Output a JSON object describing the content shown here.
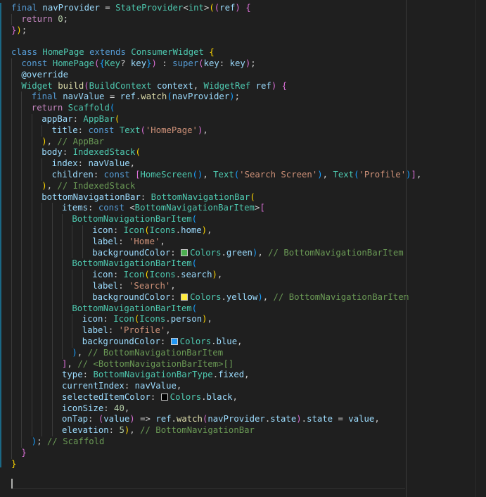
{
  "editor": {
    "language": "dart",
    "indent_guide_color": "#3a3a3a",
    "change_bar_color": "#1b81a8",
    "lines": [
      {
        "indent": 0,
        "tokens": [
          [
            "k",
            "final "
          ],
          [
            "v",
            "navProvider "
          ],
          [
            "p",
            "= "
          ],
          [
            "t",
            "StateProvider"
          ],
          [
            "p",
            "<"
          ],
          [
            "t",
            "int"
          ],
          [
            "p",
            ">"
          ],
          [
            "b1",
            "("
          ],
          [
            "b2",
            "("
          ],
          [
            "v",
            "ref"
          ],
          [
            "b2",
            ")"
          ],
          [
            "p",
            " "
          ],
          [
            "b2",
            "{"
          ]
        ]
      },
      {
        "indent": 1,
        "tokens": [
          [
            "kc",
            "return "
          ],
          [
            "n",
            "0"
          ],
          [
            "p",
            ";"
          ]
        ]
      },
      {
        "indent": 0,
        "tokens": [
          [
            "b2",
            "}"
          ],
          [
            "b1",
            ")"
          ],
          [
            "p",
            ";"
          ]
        ]
      },
      {
        "indent": 0,
        "tokens": []
      },
      {
        "indent": 0,
        "tokens": [
          [
            "k",
            "class "
          ],
          [
            "t",
            "HomePage "
          ],
          [
            "k",
            "extends "
          ],
          [
            "t",
            "ConsumerWidget "
          ],
          [
            "b1",
            "{"
          ]
        ]
      },
      {
        "indent": 1,
        "tokens": [
          [
            "k",
            "const "
          ],
          [
            "t",
            "HomePage"
          ],
          [
            "b2",
            "("
          ],
          [
            "b3",
            "{"
          ],
          [
            "t",
            "Key"
          ],
          [
            "p",
            "? "
          ],
          [
            "v",
            "key"
          ],
          [
            "b3",
            "}"
          ],
          [
            "b2",
            ")"
          ],
          [
            "p",
            " : "
          ],
          [
            "k",
            "super"
          ],
          [
            "b2",
            "("
          ],
          [
            "v",
            "key"
          ],
          [
            "p",
            ": "
          ],
          [
            "v",
            "key"
          ],
          [
            "b2",
            ")"
          ],
          [
            "p",
            ";"
          ]
        ]
      },
      {
        "indent": 1,
        "tokens": [
          [
            "v",
            "@override"
          ]
        ]
      },
      {
        "indent": 1,
        "tokens": [
          [
            "t",
            "Widget "
          ],
          [
            "f",
            "build"
          ],
          [
            "b2",
            "("
          ],
          [
            "t",
            "BuildContext "
          ],
          [
            "v",
            "context"
          ],
          [
            "p",
            ", "
          ],
          [
            "t",
            "WidgetRef "
          ],
          [
            "v",
            "ref"
          ],
          [
            "b2",
            ")"
          ],
          [
            "p",
            " "
          ],
          [
            "b2",
            "{"
          ]
        ]
      },
      {
        "indent": 2,
        "tokens": [
          [
            "k",
            "final "
          ],
          [
            "v",
            "navValue "
          ],
          [
            "p",
            "= "
          ],
          [
            "v",
            "ref"
          ],
          [
            "p",
            "."
          ],
          [
            "f",
            "watch"
          ],
          [
            "b3",
            "("
          ],
          [
            "v",
            "navProvider"
          ],
          [
            "b3",
            ")"
          ],
          [
            "p",
            ";"
          ]
        ]
      },
      {
        "indent": 2,
        "tokens": [
          [
            "kc",
            "return "
          ],
          [
            "t",
            "Scaffold"
          ],
          [
            "b3",
            "("
          ]
        ]
      },
      {
        "indent": 3,
        "tokens": [
          [
            "v",
            "appBar"
          ],
          [
            "p",
            ": "
          ],
          [
            "t",
            "AppBar"
          ],
          [
            "b1",
            "("
          ]
        ]
      },
      {
        "indent": 4,
        "tokens": [
          [
            "v",
            "title"
          ],
          [
            "p",
            ": "
          ],
          [
            "k",
            "const "
          ],
          [
            "t",
            "Text"
          ],
          [
            "b2",
            "("
          ],
          [
            "s",
            "'HomePage'"
          ],
          [
            "b2",
            ")"
          ],
          [
            "p",
            ","
          ]
        ]
      },
      {
        "indent": 3,
        "tokens": [
          [
            "b1",
            ")"
          ],
          [
            "p",
            ", "
          ],
          [
            "c",
            "// AppBar"
          ]
        ]
      },
      {
        "indent": 3,
        "tokens": [
          [
            "v",
            "body"
          ],
          [
            "p",
            ": "
          ],
          [
            "t",
            "IndexedStack"
          ],
          [
            "b1",
            "("
          ]
        ]
      },
      {
        "indent": 4,
        "tokens": [
          [
            "v",
            "index"
          ],
          [
            "p",
            ": "
          ],
          [
            "v",
            "navValue"
          ],
          [
            "p",
            ","
          ]
        ]
      },
      {
        "indent": 4,
        "tokens": [
          [
            "v",
            "children"
          ],
          [
            "p",
            ": "
          ],
          [
            "k",
            "const "
          ],
          [
            "b2",
            "["
          ],
          [
            "t",
            "HomeScreen"
          ],
          [
            "b3",
            "()"
          ],
          [
            "p",
            ", "
          ],
          [
            "t",
            "Text"
          ],
          [
            "b3",
            "("
          ],
          [
            "s",
            "'Search Screen'"
          ],
          [
            "b3",
            ")"
          ],
          [
            "p",
            ", "
          ],
          [
            "t",
            "Text"
          ],
          [
            "b3",
            "("
          ],
          [
            "s",
            "'Profile'"
          ],
          [
            "b3",
            ")"
          ],
          [
            "b2",
            "]"
          ],
          [
            "p",
            ","
          ]
        ]
      },
      {
        "indent": 3,
        "tokens": [
          [
            "b1",
            ")"
          ],
          [
            "p",
            ", "
          ],
          [
            "c",
            "// IndexedStack"
          ]
        ]
      },
      {
        "indent": 3,
        "tokens": [
          [
            "v",
            "bottomNavigationBar"
          ],
          [
            "p",
            ": "
          ],
          [
            "t",
            "BottomNavigationBar"
          ],
          [
            "b1",
            "("
          ]
        ]
      },
      {
        "indent": 5,
        "tokens": [
          [
            "v",
            "items"
          ],
          [
            "p",
            ": "
          ],
          [
            "k",
            "const "
          ],
          [
            "p",
            "<"
          ],
          [
            "t",
            "BottomNavigationBarItem"
          ],
          [
            "p",
            ">"
          ],
          [
            "b2",
            "["
          ]
        ]
      },
      {
        "indent": 6,
        "tokens": [
          [
            "t",
            "BottomNavigationBarItem"
          ],
          [
            "b3",
            "("
          ]
        ]
      },
      {
        "indent": 8,
        "tokens": [
          [
            "v",
            "icon"
          ],
          [
            "p",
            ": "
          ],
          [
            "t",
            "Icon"
          ],
          [
            "b1",
            "("
          ],
          [
            "t",
            "Icons"
          ],
          [
            "p",
            "."
          ],
          [
            "v",
            "home"
          ],
          [
            "b1",
            ")"
          ],
          [
            "p",
            ","
          ]
        ]
      },
      {
        "indent": 8,
        "tokens": [
          [
            "v",
            "label"
          ],
          [
            "p",
            ": "
          ],
          [
            "s",
            "'Home'"
          ],
          [
            "p",
            ","
          ]
        ]
      },
      {
        "indent": 8,
        "tokens": [
          [
            "v",
            "backgroundColor"
          ],
          [
            "p",
            ": "
          ],
          [
            "swatch",
            "#4caf50"
          ],
          [
            "t",
            "Colors"
          ],
          [
            "p",
            "."
          ],
          [
            "v",
            "green"
          ],
          [
            "b3",
            ")"
          ],
          [
            "p",
            ", "
          ],
          [
            "c",
            "// BottomNavigationBarItem"
          ]
        ]
      },
      {
        "indent": 6,
        "tokens": [
          [
            "t",
            "BottomNavigationBarItem"
          ],
          [
            "b3",
            "("
          ]
        ]
      },
      {
        "indent": 8,
        "tokens": [
          [
            "v",
            "icon"
          ],
          [
            "p",
            ": "
          ],
          [
            "t",
            "Icon"
          ],
          [
            "b1",
            "("
          ],
          [
            "t",
            "Icons"
          ],
          [
            "p",
            "."
          ],
          [
            "v",
            "search"
          ],
          [
            "b1",
            ")"
          ],
          [
            "p",
            ","
          ]
        ]
      },
      {
        "indent": 8,
        "tokens": [
          [
            "v",
            "label"
          ],
          [
            "p",
            ": "
          ],
          [
            "s",
            "'Search'"
          ],
          [
            "p",
            ","
          ]
        ]
      },
      {
        "indent": 8,
        "tokens": [
          [
            "v",
            "backgroundColor"
          ],
          [
            "p",
            ": "
          ],
          [
            "swatch",
            "#ffeb3b"
          ],
          [
            "t",
            "Colors"
          ],
          [
            "p",
            "."
          ],
          [
            "v",
            "yellow"
          ],
          [
            "b3",
            ")"
          ],
          [
            "p",
            ", "
          ],
          [
            "c",
            "// BottomNavigationBarItem"
          ]
        ]
      },
      {
        "indent": 6,
        "tokens": [
          [
            "t",
            "BottomNavigationBarItem"
          ],
          [
            "b3",
            "("
          ]
        ]
      },
      {
        "indent": 7,
        "tokens": [
          [
            "v",
            "icon"
          ],
          [
            "p",
            ": "
          ],
          [
            "t",
            "Icon"
          ],
          [
            "b1",
            "("
          ],
          [
            "t",
            "Icons"
          ],
          [
            "p",
            "."
          ],
          [
            "v",
            "person"
          ],
          [
            "b1",
            ")"
          ],
          [
            "p",
            ","
          ]
        ]
      },
      {
        "indent": 7,
        "tokens": [
          [
            "v",
            "label"
          ],
          [
            "p",
            ": "
          ],
          [
            "s",
            "'Profile'"
          ],
          [
            "p",
            ","
          ]
        ]
      },
      {
        "indent": 7,
        "tokens": [
          [
            "v",
            "backgroundColor"
          ],
          [
            "p",
            ": "
          ],
          [
            "swatch",
            "#2196f3"
          ],
          [
            "t",
            "Colors"
          ],
          [
            "p",
            "."
          ],
          [
            "v",
            "blue"
          ],
          [
            "p",
            ","
          ]
        ]
      },
      {
        "indent": 6,
        "tokens": [
          [
            "b3",
            ")"
          ],
          [
            "p",
            ", "
          ],
          [
            "c",
            "// BottomNavigationBarItem"
          ]
        ]
      },
      {
        "indent": 5,
        "tokens": [
          [
            "b2",
            "]"
          ],
          [
            "p",
            ", "
          ],
          [
            "c",
            "// <BottomNavigationBarItem>[]"
          ]
        ]
      },
      {
        "indent": 5,
        "tokens": [
          [
            "v",
            "type"
          ],
          [
            "p",
            ": "
          ],
          [
            "t",
            "BottomNavigationBarType"
          ],
          [
            "p",
            "."
          ],
          [
            "v",
            "fixed"
          ],
          [
            "p",
            ","
          ]
        ]
      },
      {
        "indent": 5,
        "tokens": [
          [
            "v",
            "currentIndex"
          ],
          [
            "p",
            ": "
          ],
          [
            "v",
            "navValue"
          ],
          [
            "p",
            ","
          ]
        ]
      },
      {
        "indent": 5,
        "tokens": [
          [
            "v",
            "selectedItemColor"
          ],
          [
            "p",
            ": "
          ],
          [
            "swatch",
            "#000000"
          ],
          [
            "t",
            "Colors"
          ],
          [
            "p",
            "."
          ],
          [
            "v",
            "black"
          ],
          [
            "p",
            ","
          ]
        ]
      },
      {
        "indent": 5,
        "tokens": [
          [
            "v",
            "iconSize"
          ],
          [
            "p",
            ": "
          ],
          [
            "n",
            "40"
          ],
          [
            "p",
            ","
          ]
        ]
      },
      {
        "indent": 5,
        "tokens": [
          [
            "v",
            "onTap"
          ],
          [
            "p",
            ": "
          ],
          [
            "b2",
            "("
          ],
          [
            "v",
            "value"
          ],
          [
            "b2",
            ")"
          ],
          [
            "p",
            " => "
          ],
          [
            "v",
            "ref"
          ],
          [
            "p",
            "."
          ],
          [
            "f",
            "watch"
          ],
          [
            "b2",
            "("
          ],
          [
            "v",
            "navProvider"
          ],
          [
            "p",
            "."
          ],
          [
            "v",
            "state"
          ],
          [
            "b2",
            ")"
          ],
          [
            "p",
            "."
          ],
          [
            "v",
            "state "
          ],
          [
            "p",
            "= "
          ],
          [
            "v",
            "value"
          ],
          [
            "p",
            ","
          ]
        ]
      },
      {
        "indent": 5,
        "tokens": [
          [
            "v",
            "elevation"
          ],
          [
            "p",
            ": "
          ],
          [
            "n",
            "5"
          ],
          [
            "b1",
            ")"
          ],
          [
            "p",
            ", "
          ],
          [
            "c",
            "// BottomNavigationBar"
          ]
        ]
      },
      {
        "indent": 2,
        "tokens": [
          [
            "b3",
            ")"
          ],
          [
            "p",
            "; "
          ],
          [
            "c",
            "// Scaffold"
          ]
        ]
      },
      {
        "indent": 1,
        "tokens": [
          [
            "b2",
            "}"
          ]
        ]
      },
      {
        "indent": 0,
        "tokens": [
          [
            "b1",
            "}"
          ]
        ]
      },
      {
        "indent": 0,
        "tokens": []
      }
    ]
  }
}
